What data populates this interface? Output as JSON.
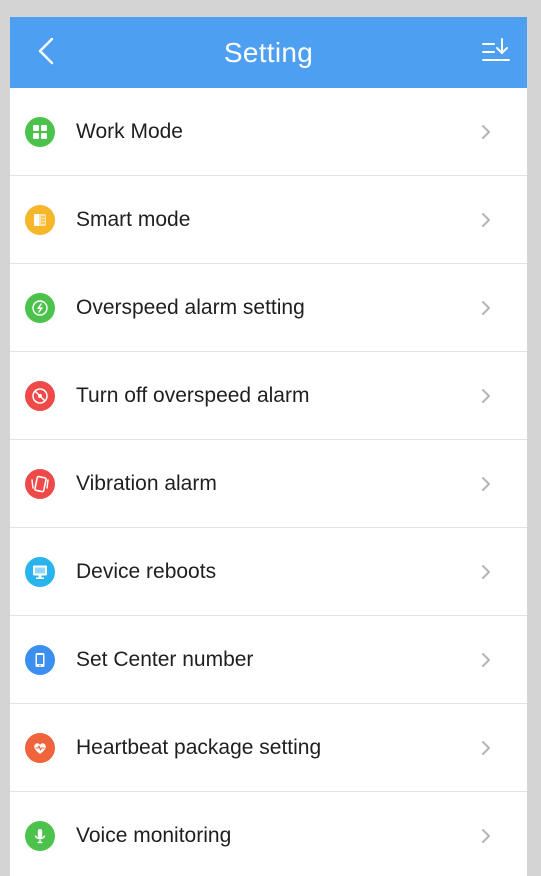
{
  "header": {
    "title": "Setting",
    "background": "#4d9ff2",
    "back_icon": "chevron-left-icon",
    "sort_icon": "sort-descending-icon"
  },
  "items": [
    {
      "key": "work-mode",
      "label": "Work Mode",
      "icon": "grid-icon",
      "color": "#4cc24c"
    },
    {
      "key": "smart-mode",
      "label": "Smart mode",
      "icon": "document-icon",
      "color": "#f7b52a"
    },
    {
      "key": "overspeed-alarm-setting",
      "label": "Overspeed alarm setting",
      "icon": "lightning-icon",
      "color": "#4cc24c"
    },
    {
      "key": "turn-off-overspeed-alarm",
      "label": "Turn off overspeed alarm",
      "icon": "no-speed-icon",
      "color": "#ef4a4a"
    },
    {
      "key": "vibration-alarm",
      "label": "Vibration alarm",
      "icon": "vibrating-phone-icon",
      "color": "#ef4a4a"
    },
    {
      "key": "device-reboots",
      "label": "Device reboots",
      "icon": "monitor-icon",
      "color": "#2ab4ee"
    },
    {
      "key": "set-center-number",
      "label": "Set Center number",
      "icon": "phone-icon",
      "color": "#3c8ff0"
    },
    {
      "key": "heartbeat-package-setting",
      "label": "Heartbeat package setting",
      "icon": "heart-icon",
      "color": "#f0643c"
    },
    {
      "key": "voice-monitoring",
      "label": "Voice monitoring",
      "icon": "microphone-icon",
      "color": "#4cc24c"
    }
  ],
  "chevron_color": "#b5b5b5"
}
